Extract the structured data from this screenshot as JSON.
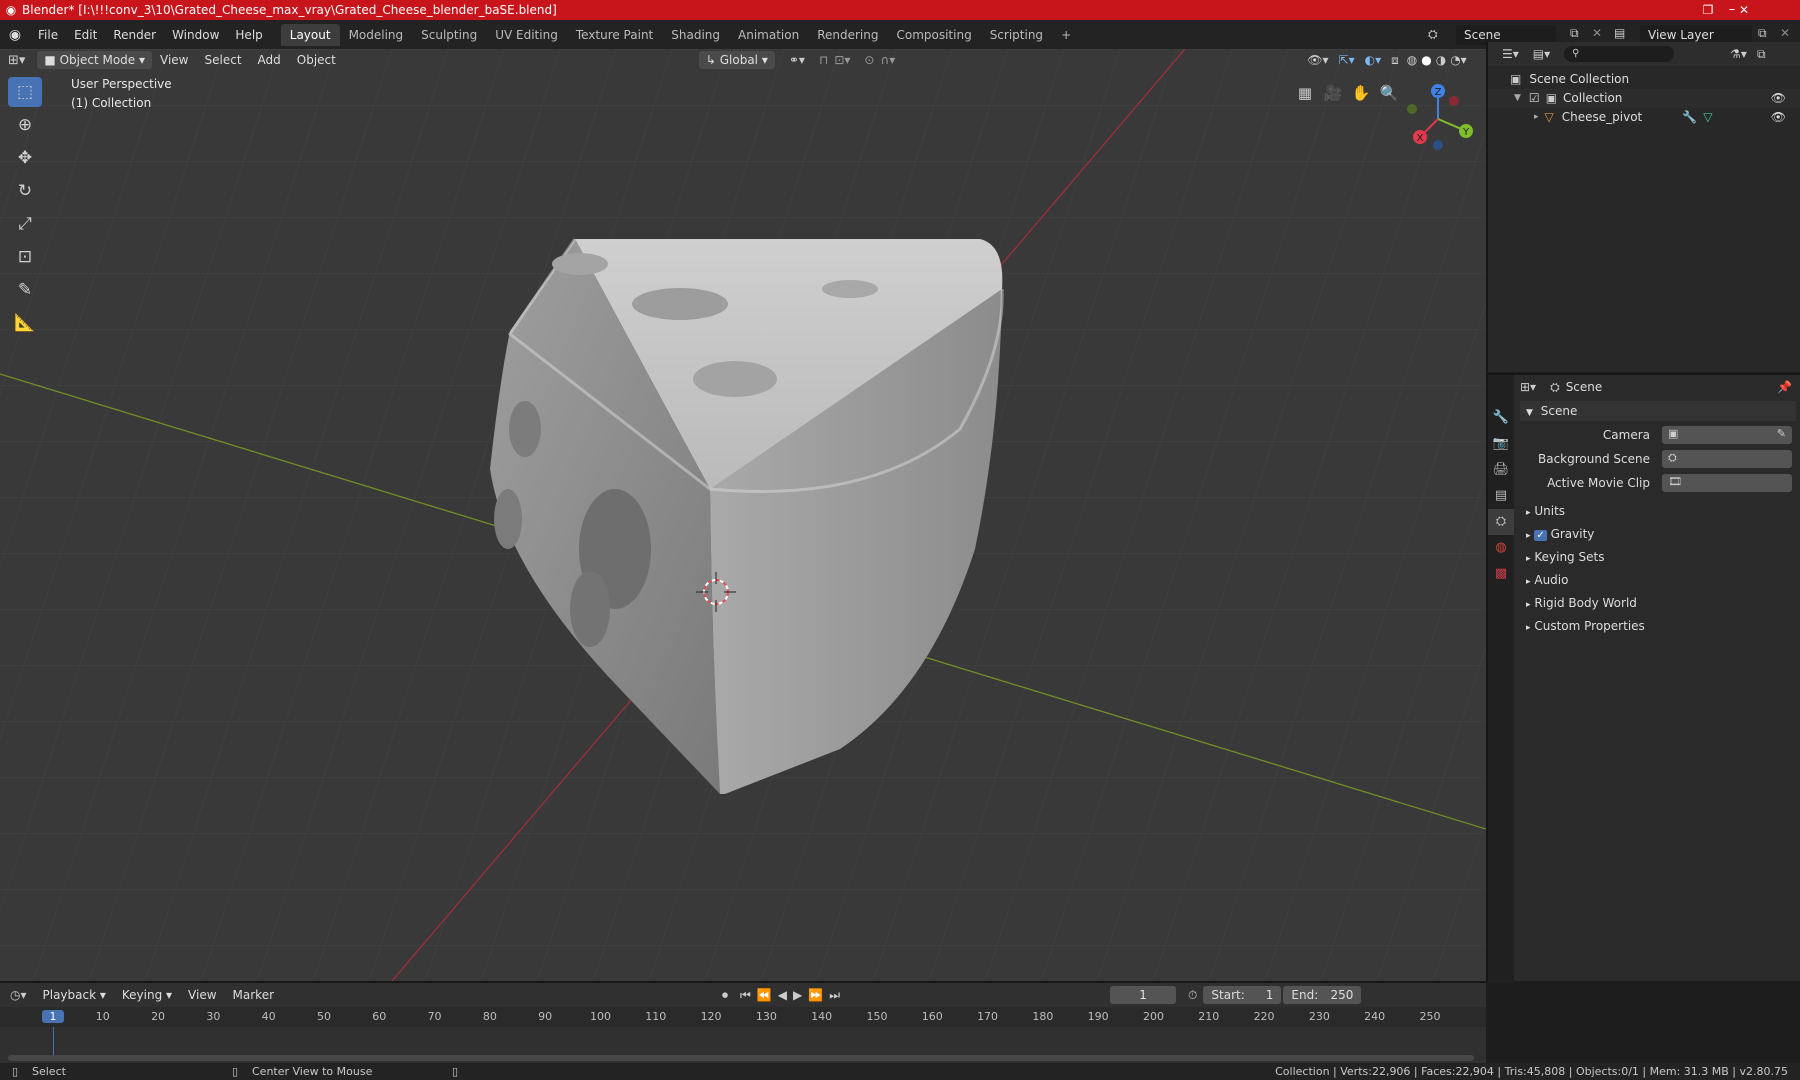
{
  "title": "Blender* [I:\\!!!conv_3\\10\\Grated_Cheese_max_vray\\Grated_Cheese_blender_baSE.blend]",
  "window_controls": [
    "–",
    "❐",
    "✕"
  ],
  "menu": [
    "File",
    "Edit",
    "Render",
    "Window",
    "Help"
  ],
  "workspaces": [
    "Layout",
    "Modeling",
    "Sculpting",
    "UV Editing",
    "Texture Paint",
    "Shading",
    "Animation",
    "Rendering",
    "Compositing",
    "Scripting",
    "+"
  ],
  "scene_name": "Scene",
  "view_layer": "View Layer",
  "header": {
    "mode": "Object Mode",
    "view": "View",
    "select": "Select",
    "add": "Add",
    "object": "Object",
    "orientation": "Global"
  },
  "viewport": {
    "perspective": "User Perspective",
    "collection": "(1) Collection"
  },
  "gizmo": {
    "x": "X",
    "y": "Y",
    "z": "Z"
  },
  "outliner": {
    "root": "Scene Collection",
    "collection": "Collection",
    "object": "Cheese_pivot"
  },
  "properties": {
    "context": "Scene",
    "panel": "Scene",
    "camera_label": "Camera",
    "bg_scene_label": "Background Scene",
    "movie_clip_label": "Active Movie Clip",
    "sections": [
      "Units",
      "Gravity",
      "Keying Sets",
      "Audio",
      "Rigid Body World",
      "Custom Properties"
    ]
  },
  "timeline": {
    "menus": [
      "Playback",
      "Keying",
      "View",
      "Marker"
    ],
    "current_frame": "1",
    "start_label": "Start:",
    "start": "1",
    "end_label": "End:",
    "end": "250",
    "ticks": [
      "1",
      "10",
      "20",
      "30",
      "40",
      "50",
      "60",
      "70",
      "80",
      "90",
      "100",
      "110",
      "120",
      "130",
      "140",
      "150",
      "160",
      "170",
      "180",
      "190",
      "200",
      "210",
      "220",
      "230",
      "240",
      "250"
    ]
  },
  "status": {
    "left": "Select",
    "middle": "Center View to Mouse",
    "right": "Collection | Verts:22,906 | Faces:22,904 | Tris:45,808 | Objects:0/1 | Mem: 31.3 MB | v2.80.75"
  },
  "colors": {
    "accent": "#4772b3",
    "titlebar": "#c8141b",
    "x_axis": "#e23a4c",
    "y_axis": "#7fbf2a",
    "z_axis": "#3e82e5"
  }
}
